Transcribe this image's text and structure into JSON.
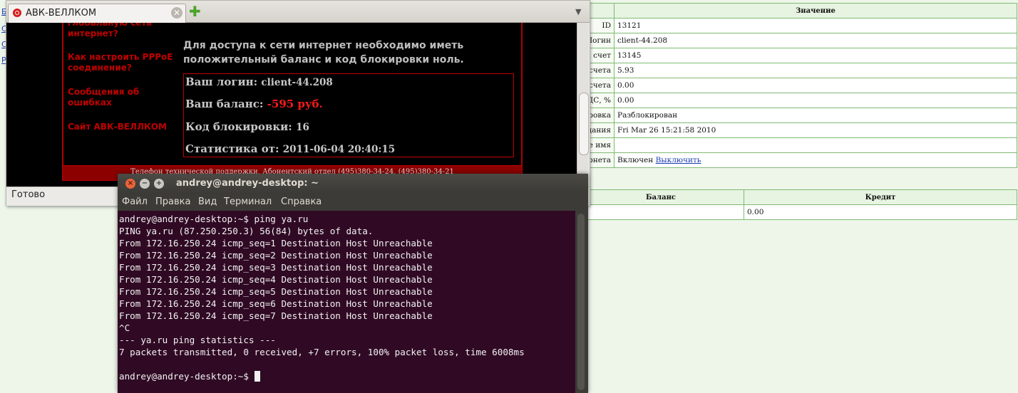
{
  "background_page": {
    "side_links": [
      "Б",
      "С",
      "С",
      "Р"
    ],
    "account_table": {
      "header_value": "Значение",
      "rows": [
        {
          "label": "ID",
          "value": "13121"
        },
        {
          "label": "Логин",
          "value": "client-44.208"
        },
        {
          "label": "й счет",
          "value": "13145"
        },
        {
          "label": "счета",
          "value": "5.93"
        },
        {
          "label": "счета",
          "value": "0.00"
        },
        {
          "label": "ДС, %",
          "value": "0.00"
        },
        {
          "label": "ровка",
          "value": "Разблокирован"
        },
        {
          "label": "здания",
          "value": "Fri Mar 26 15:21:58 2010"
        },
        {
          "label": "е имя",
          "value": ""
        },
        {
          "label": "рнета",
          "value": "Включен",
          "link": "Выключить"
        }
      ]
    },
    "balance_table": {
      "headers": [
        "Баланс",
        "Кредит"
      ],
      "row": [
        "",
        "0.00"
      ]
    }
  },
  "browser": {
    "tab_title": "АВК-ВЕЛЛКОМ",
    "tab_close": "✕",
    "new_tab": "✚",
    "tab_list_arrow": "▼",
    "status": "Готово",
    "site": {
      "menu": [
        "глобальную сеть интернет?",
        "Как настроить PPPoE соединение?",
        "Сообщения об ошибках",
        "Сайт АВК-ВЕЛЛКОМ"
      ],
      "notice": "Для доступа к сети интернет необходимо иметь положительный баланс и код блокировки ноль.",
      "info": {
        "login_label": "Ваш логин:",
        "login_value": "client-44.208",
        "balance_label": "Ваш баланс:",
        "balance_value": "-595 руб.",
        "block_label": "Код блокировки:",
        "block_value": "16",
        "stats_label": "Статистика от:",
        "stats_value": "2011-06-04 20:40:15"
      },
      "footer": "Телефон технической поддержки, Абонентский отдел (495)380-34-24, (495)380-34-21"
    }
  },
  "terminal": {
    "title": "andrey@andrey-desktop: ~",
    "buttons": {
      "close": "×",
      "minimize": "−",
      "maximize": "+"
    },
    "menu": [
      "Файл",
      "Правка",
      "Вид",
      "Терминал",
      "Справка"
    ],
    "output": "andrey@andrey-desktop:~$ ping ya.ru\nPING ya.ru (87.250.250.3) 56(84) bytes of data.\nFrom 172.16.250.24 icmp_seq=1 Destination Host Unreachable\nFrom 172.16.250.24 icmp_seq=2 Destination Host Unreachable\nFrom 172.16.250.24 icmp_seq=3 Destination Host Unreachable\nFrom 172.16.250.24 icmp_seq=4 Destination Host Unreachable\nFrom 172.16.250.24 icmp_seq=5 Destination Host Unreachable\nFrom 172.16.250.24 icmp_seq=6 Destination Host Unreachable\nFrom 172.16.250.24 icmp_seq=7 Destination Host Unreachable\n^C\n--- ya.ru ping statistics ---\n7 packets transmitted, 0 received, +7 errors, 100% packet loss, time 6008ms\n\n",
    "prompt": "andrey@andrey-desktop:~$ "
  },
  "colors": {
    "terminal_bg": "#300a24",
    "site_accent": "#c00000",
    "balance_negative": "#ff1a1a",
    "page_bg": "#eef6ea"
  }
}
